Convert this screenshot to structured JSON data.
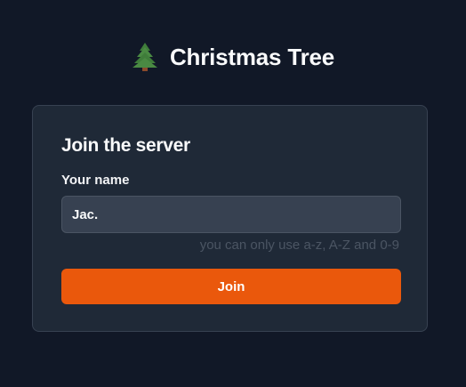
{
  "header": {
    "icon": "christmas-tree-icon",
    "title": "Christmas Tree"
  },
  "card": {
    "title": "Join the server",
    "name_label": "Your name",
    "name_value": "Jac.",
    "hint": "you can only use a-z, A-Z and 0-9",
    "join_label": "Join"
  },
  "colors": {
    "background": "#111827",
    "card": "#1f2937",
    "input": "#374151",
    "accent": "#ea580c"
  }
}
